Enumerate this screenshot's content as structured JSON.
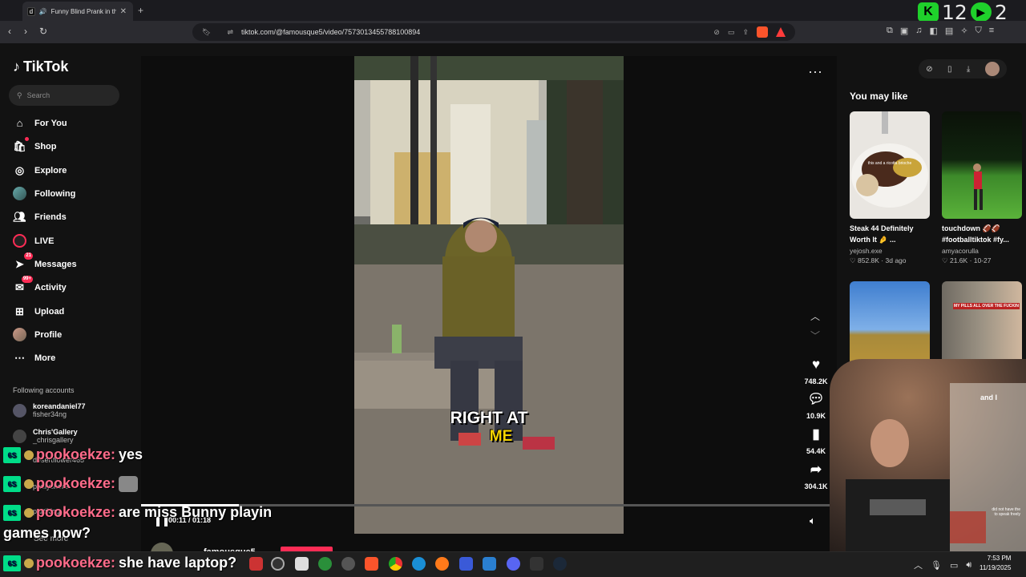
{
  "browser": {
    "tab_title": "Funny Blind Prank in the Hoo",
    "tab_icon": "d",
    "new_tab": "+",
    "url": "tiktok.com/@famousque5/video/7573013455788100894",
    "badge_k": "K",
    "badge_num1": "12",
    "badge_num2": "2"
  },
  "sidebar": {
    "logo": "TikTok",
    "search_placeholder": "Search",
    "items": [
      {
        "label": "For You",
        "icon": "home-icon"
      },
      {
        "label": "Shop",
        "icon": "shop-icon"
      },
      {
        "label": "Explore",
        "icon": "compass-icon"
      },
      {
        "label": "Following",
        "icon": "avatar-icon"
      },
      {
        "label": "Friends",
        "icon": "friends-icon"
      },
      {
        "label": "LIVE",
        "icon": "live-icon"
      },
      {
        "label": "Messages",
        "icon": "messages-icon",
        "badge": "21"
      },
      {
        "label": "Activity",
        "icon": "activity-icon",
        "badge": "99+"
      },
      {
        "label": "Upload",
        "icon": "upload-icon"
      },
      {
        "label": "Profile",
        "icon": "avatar-icon"
      },
      {
        "label": "More",
        "icon": "more-icon"
      }
    ],
    "following_header": "Following accounts",
    "following": [
      {
        "name": "koreandaniel77",
        "handle": "fisher34ng"
      },
      {
        "name": "Chris'Gallery",
        "handle": "_chrisgallery"
      },
      {
        "name": "",
        "handle": "desertflower465"
      },
      {
        "name": "",
        "handle": "paulyshore"
      },
      {
        "name": "",
        "handle": "partiking"
      }
    ],
    "see_more": "See more"
  },
  "video": {
    "caption_line1": "RIGHT AT",
    "caption_line2": "ME",
    "likes": "748.2K",
    "comments": "10.9K",
    "saves": "54.4K",
    "shares": "304.1K",
    "time": "00:11 / 01:18",
    "progress_fraction": 0.14,
    "author": "famousque5"
  },
  "recommendations": {
    "title": "You may like",
    "cards": [
      {
        "title": "Steak 44 Definitely Worth It 🤌 ...",
        "user": "yejosh.exe",
        "views": "852.8K",
        "age": "3d ago",
        "overlay": "this and a ricotta brioche"
      },
      {
        "title": "touchdown 🏈🏈 #footballtiktok #fy...",
        "user": "amyacorulla",
        "views": "21.6K",
        "age": "10-27",
        "overlay": ""
      },
      {
        "title": "",
        "user": "",
        "views": "",
        "age": "",
        "overlay": ""
      },
      {
        "title": "",
        "user": "",
        "views": "",
        "age": "",
        "overlay": "MY PILLS ALL OVER THE FUCKIN"
      }
    ],
    "partial_text": "and I",
    "webcam_text": "did not have the\nto speak freely"
  },
  "chat": [
    {
      "user": "pookoekze:",
      "message": "yes"
    },
    {
      "user": "pookoekze:",
      "message": ""
    },
    {
      "user": "pookoekze:",
      "message": "are miss Bunny playin"
    },
    {
      "user": "",
      "message": "games now?"
    },
    {
      "user": "pookoekze:",
      "message": "she have laptop?"
    }
  ],
  "taskbar": {
    "time": "7:53 PM",
    "date": "11/19/2025"
  },
  "colors": {
    "tiktok_red": "#fe2c55",
    "kick_green": "#1fd12b",
    "brave_orange": "#fb542b"
  }
}
